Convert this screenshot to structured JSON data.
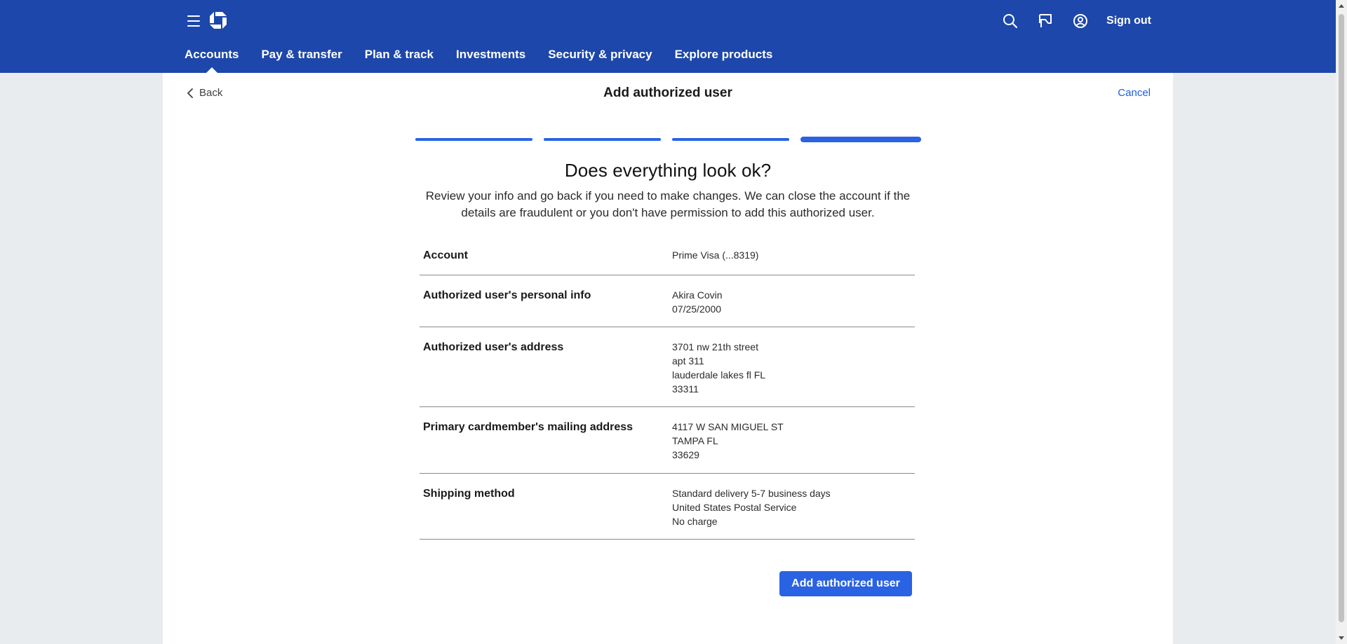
{
  "header": {
    "sign_out_label": "Sign out",
    "nav": [
      {
        "label": "Accounts",
        "active": true
      },
      {
        "label": "Pay & transfer"
      },
      {
        "label": "Plan & track"
      },
      {
        "label": "Investments"
      },
      {
        "label": "Security & privacy"
      },
      {
        "label": "Explore products"
      }
    ],
    "icons": [
      "menu-icon",
      "bank-logo",
      "search-icon",
      "messages-flag-icon",
      "profile-icon"
    ],
    "brand_color": "#1d47aa"
  },
  "page": {
    "back_label": "Back",
    "title": "Add authorized user",
    "cancel_label": "Cancel",
    "progress": {
      "current_step": 4,
      "total_steps": 4
    },
    "heading": "Does everything look ok?",
    "subtext": "Review your info and go back if you need to make changes. We can close the account if the details are fraudulent or you don't have permission to add this authorized user.",
    "accent_color": "#2a62e4"
  },
  "review": {
    "rows": [
      {
        "label": "Account",
        "lines": [
          "Prime Visa (...8319)"
        ]
      },
      {
        "label": "Authorized user's personal info",
        "lines": [
          "Akira Covin",
          "07/25/2000"
        ]
      },
      {
        "label": "Authorized user's address",
        "lines": [
          "3701 nw 21th street",
          "apt 311",
          "lauderdale lakes fl FL",
          "33311"
        ]
      },
      {
        "label": "Primary cardmember's mailing address",
        "lines": [
          "4117 W SAN MIGUEL ST",
          "TAMPA FL",
          "33629"
        ]
      },
      {
        "label": "Shipping method",
        "lines": [
          "Standard delivery 5-7 business days",
          "United States Postal Service",
          "No charge"
        ]
      }
    ]
  },
  "actions": {
    "submit_label": "Add authorized user"
  }
}
